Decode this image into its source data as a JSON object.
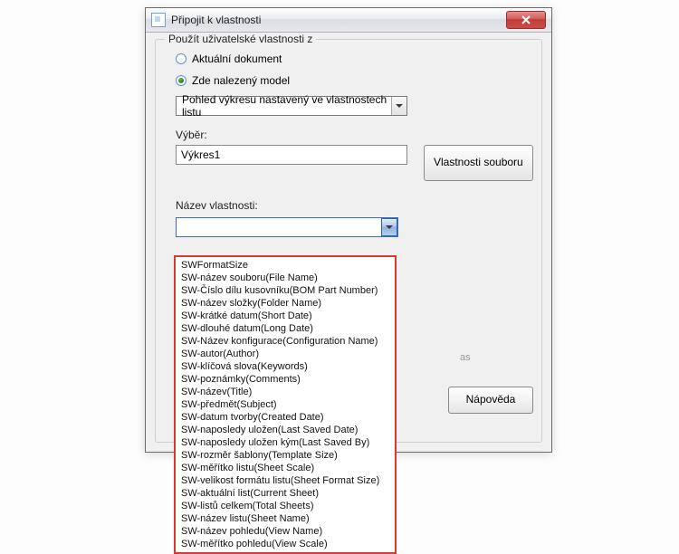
{
  "dialog": {
    "title": "Připojit k vlastnosti",
    "close_label": "X"
  },
  "group": {
    "legend": "Použít uživatelské vlastnosti z",
    "radio_current": "Aktuální dokument",
    "radio_model": "Zde nalezený model",
    "view_combo": "Pohled výkresu nastavený ve vlastnostech listu",
    "selection_label": "Výběr:",
    "selection_value": "Výkres1",
    "file_props_btn": "Vlastnosti souboru",
    "prop_name_label": "Název vlastnosti:",
    "faint_hint": "as"
  },
  "help_btn": "Nápověda",
  "property_list": [
    "SWFormatSize",
    "SW-název souboru(File Name)",
    "SW-Číslo dílu kusovníku(BOM Part Number)",
    "SW-název složky(Folder Name)",
    "SW-krátké datum(Short Date)",
    "SW-dlouhé datum(Long Date)",
    "SW-Název konfigurace(Configuration Name)",
    "SW-autor(Author)",
    "SW-klíčová slova(Keywords)",
    "SW-poznámky(Comments)",
    "SW-název(Title)",
    "SW-předmět(Subject)",
    "SW-datum tvorby(Created Date)",
    "SW-naposledy uložen(Last Saved Date)",
    "SW-naposledy uložen kým(Last Saved By)",
    "SW-rozměr šablony(Template Size)",
    "SW-měřítko listu(Sheet Scale)",
    "SW-velikost formátu listu(Sheet Format Size)",
    "SW-aktuální list(Current Sheet)",
    "SW-listů celkem(Total Sheets)",
    "SW-název listu(Sheet Name)",
    "SW-název pohledu(View Name)",
    "SW-měřítko pohledu(View Scale)"
  ]
}
